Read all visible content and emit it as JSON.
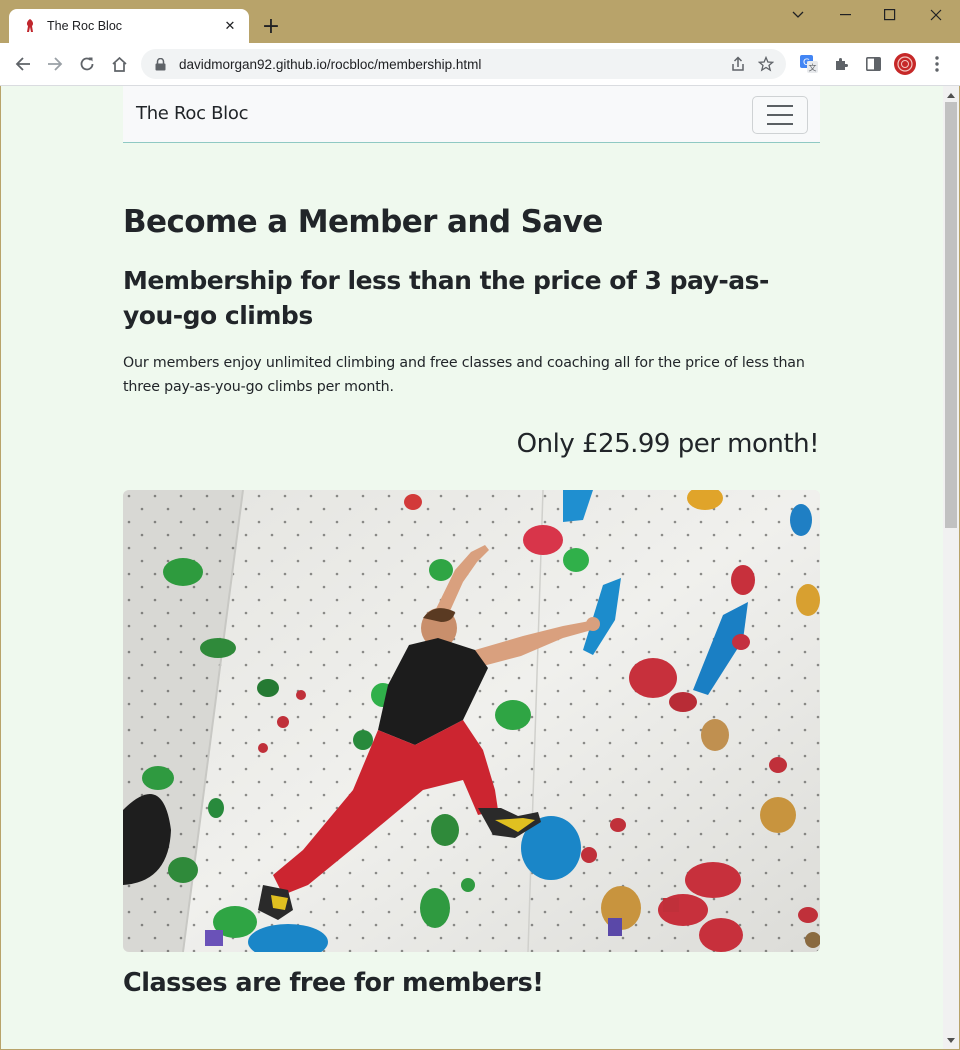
{
  "browser": {
    "tab_title": "The Roc Bloc",
    "url": "davidmorgan92.github.io/rocbloc/membership.html",
    "icons": [
      "favicon-icon",
      "close-tab-icon",
      "new-tab-icon",
      "minimize-icon",
      "maximize-icon",
      "close-window-icon",
      "back-icon",
      "forward-icon",
      "reload-icon",
      "home-icon",
      "lock-icon",
      "share-icon",
      "bookmark-star-icon",
      "translate-icon",
      "extensions-icon",
      "side-panel-icon",
      "profile-avatar",
      "menu-icon"
    ]
  },
  "navbar": {
    "brand": "The Roc Bloc",
    "toggler_icon": "hamburger-menu-icon"
  },
  "main": {
    "heading": "Become a Member and Save",
    "subheading": "Membership for less than the price of 3 pay-as-you-go climbs",
    "body": "Our members enjoy unlimited climbing and free classes and coaching all for the price of less than three pay-as-you-go climbs per month.",
    "price": "Only £25.99 per month!",
    "classes_heading": "Classes are free for members!"
  },
  "colors": {
    "page_background": "#eff9ee",
    "navbar_background": "#f8f9fa",
    "text": "#212529",
    "browser_frame": "#b8a36a"
  }
}
